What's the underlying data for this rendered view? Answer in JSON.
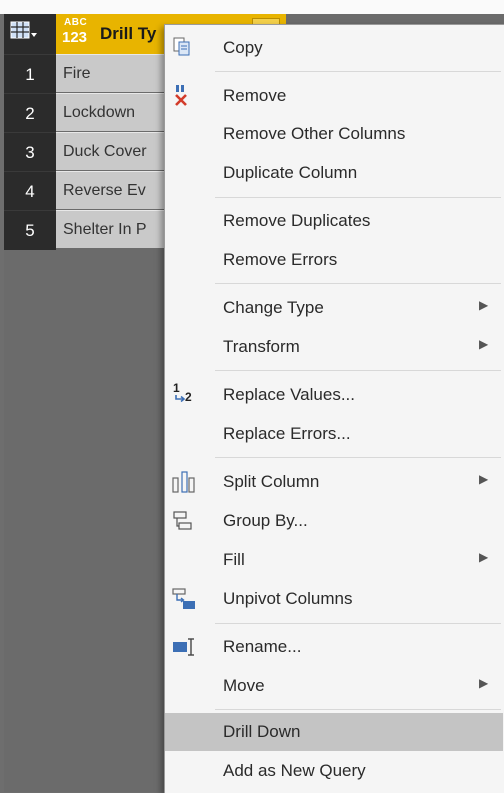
{
  "table": {
    "column_type": {
      "top": "ABC",
      "bottom": "123"
    },
    "column_title": "Drill Ty",
    "rows": [
      {
        "num": "1",
        "value": "Fire"
      },
      {
        "num": "2",
        "value": "Lockdown"
      },
      {
        "num": "3",
        "value": "Duck Cover"
      },
      {
        "num": "4",
        "value": "Reverse Ev"
      },
      {
        "num": "5",
        "value": "Shelter In P"
      }
    ]
  },
  "menu": {
    "items": [
      {
        "label": "Copy",
        "icon": "copy-icon",
        "submenu": false
      },
      {
        "label": "Remove",
        "icon": "remove-column-icon",
        "submenu": false
      },
      {
        "label": "Remove Other Columns",
        "submenu": false
      },
      {
        "label": "Duplicate Column",
        "submenu": false
      },
      {
        "label": "Remove Duplicates",
        "submenu": false
      },
      {
        "label": "Remove Errors",
        "submenu": false
      },
      {
        "label": "Change Type",
        "submenu": true
      },
      {
        "label": "Transform",
        "submenu": true
      },
      {
        "label": "Replace Values...",
        "icon": "replace-values-icon",
        "submenu": false
      },
      {
        "label": "Replace Errors...",
        "submenu": false
      },
      {
        "label": "Split Column",
        "icon": "split-column-icon",
        "submenu": true
      },
      {
        "label": "Group By...",
        "icon": "group-by-icon",
        "submenu": false
      },
      {
        "label": "Fill",
        "submenu": true
      },
      {
        "label": "Unpivot Columns",
        "icon": "unpivot-icon",
        "submenu": false
      },
      {
        "label": "Rename...",
        "icon": "rename-icon",
        "submenu": false
      },
      {
        "label": "Move",
        "submenu": true
      },
      {
        "label": "Drill Down",
        "submenu": false,
        "highlighted": true
      },
      {
        "label": "Add as New Query",
        "submenu": false
      }
    ],
    "replace_icon_digits": {
      "one": "1",
      "two": "2"
    }
  },
  "colors": {
    "header_accent": "#e8b400",
    "row_number_bg": "#2b2b2b",
    "cell_bg": "#c9c9c9",
    "menu_bg": "#f5f5f5",
    "highlight_bg": "#c4c4c4"
  }
}
